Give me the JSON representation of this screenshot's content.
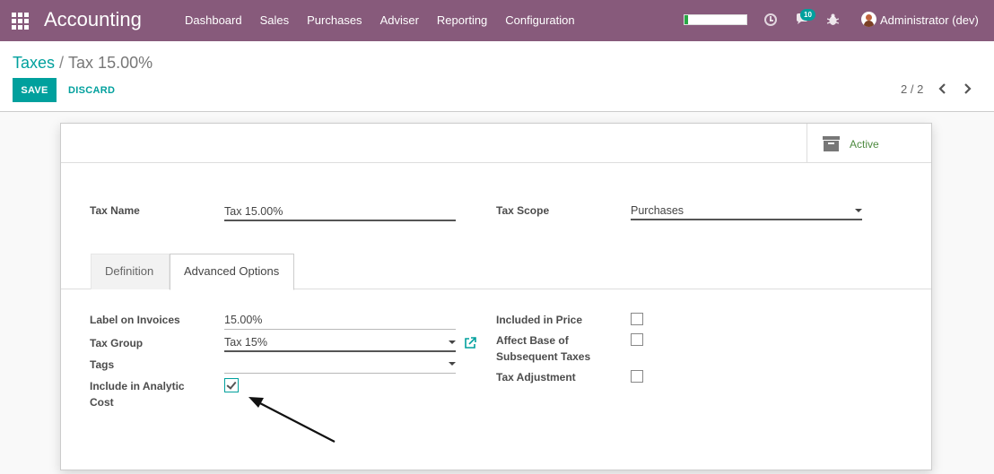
{
  "navbar": {
    "app_title": "Accounting",
    "menu": [
      "Dashboard",
      "Sales",
      "Purchases",
      "Adviser",
      "Reporting",
      "Configuration"
    ],
    "chat_count": "10",
    "user": "Administrator (dev)",
    "progress_fraction": 0.06,
    "brand_color": "#875a7b"
  },
  "control_panel": {
    "breadcrumb_parent": "Taxes",
    "breadcrumb_separator": "/",
    "breadcrumb_current": "Tax 15.00%",
    "save_label": "SAVE",
    "discard_label": "DISCARD",
    "pager": "2 / 2"
  },
  "form": {
    "active_label": "Active",
    "tax_name_label": "Tax Name",
    "tax_name_value": "Tax 15.00%",
    "tax_scope_label": "Tax Scope",
    "tax_scope_value": "Purchases",
    "tabs": [
      "Definition",
      "Advanced Options"
    ],
    "active_tab": "Advanced Options",
    "label_on_invoices_label": "Label on Invoices",
    "label_on_invoices_value": "15.00%",
    "tax_group_label": "Tax Group",
    "tax_group_value": "Tax 15%",
    "tags_label": "Tags",
    "tags_value": "",
    "include_analytic_label_1": "Include in Analytic",
    "include_analytic_label_2": "Cost",
    "include_analytic_checked": true,
    "included_in_price_label": "Included in Price",
    "included_in_price_checked": false,
    "affect_base_label_1": "Affect Base of",
    "affect_base_label_2": "Subsequent Taxes",
    "affect_base_checked": false,
    "tax_adjustment_label": "Tax Adjustment",
    "tax_adjustment_checked": false
  },
  "colors": {
    "accent": "#00a09d",
    "active_green": "#4d8a3f"
  }
}
